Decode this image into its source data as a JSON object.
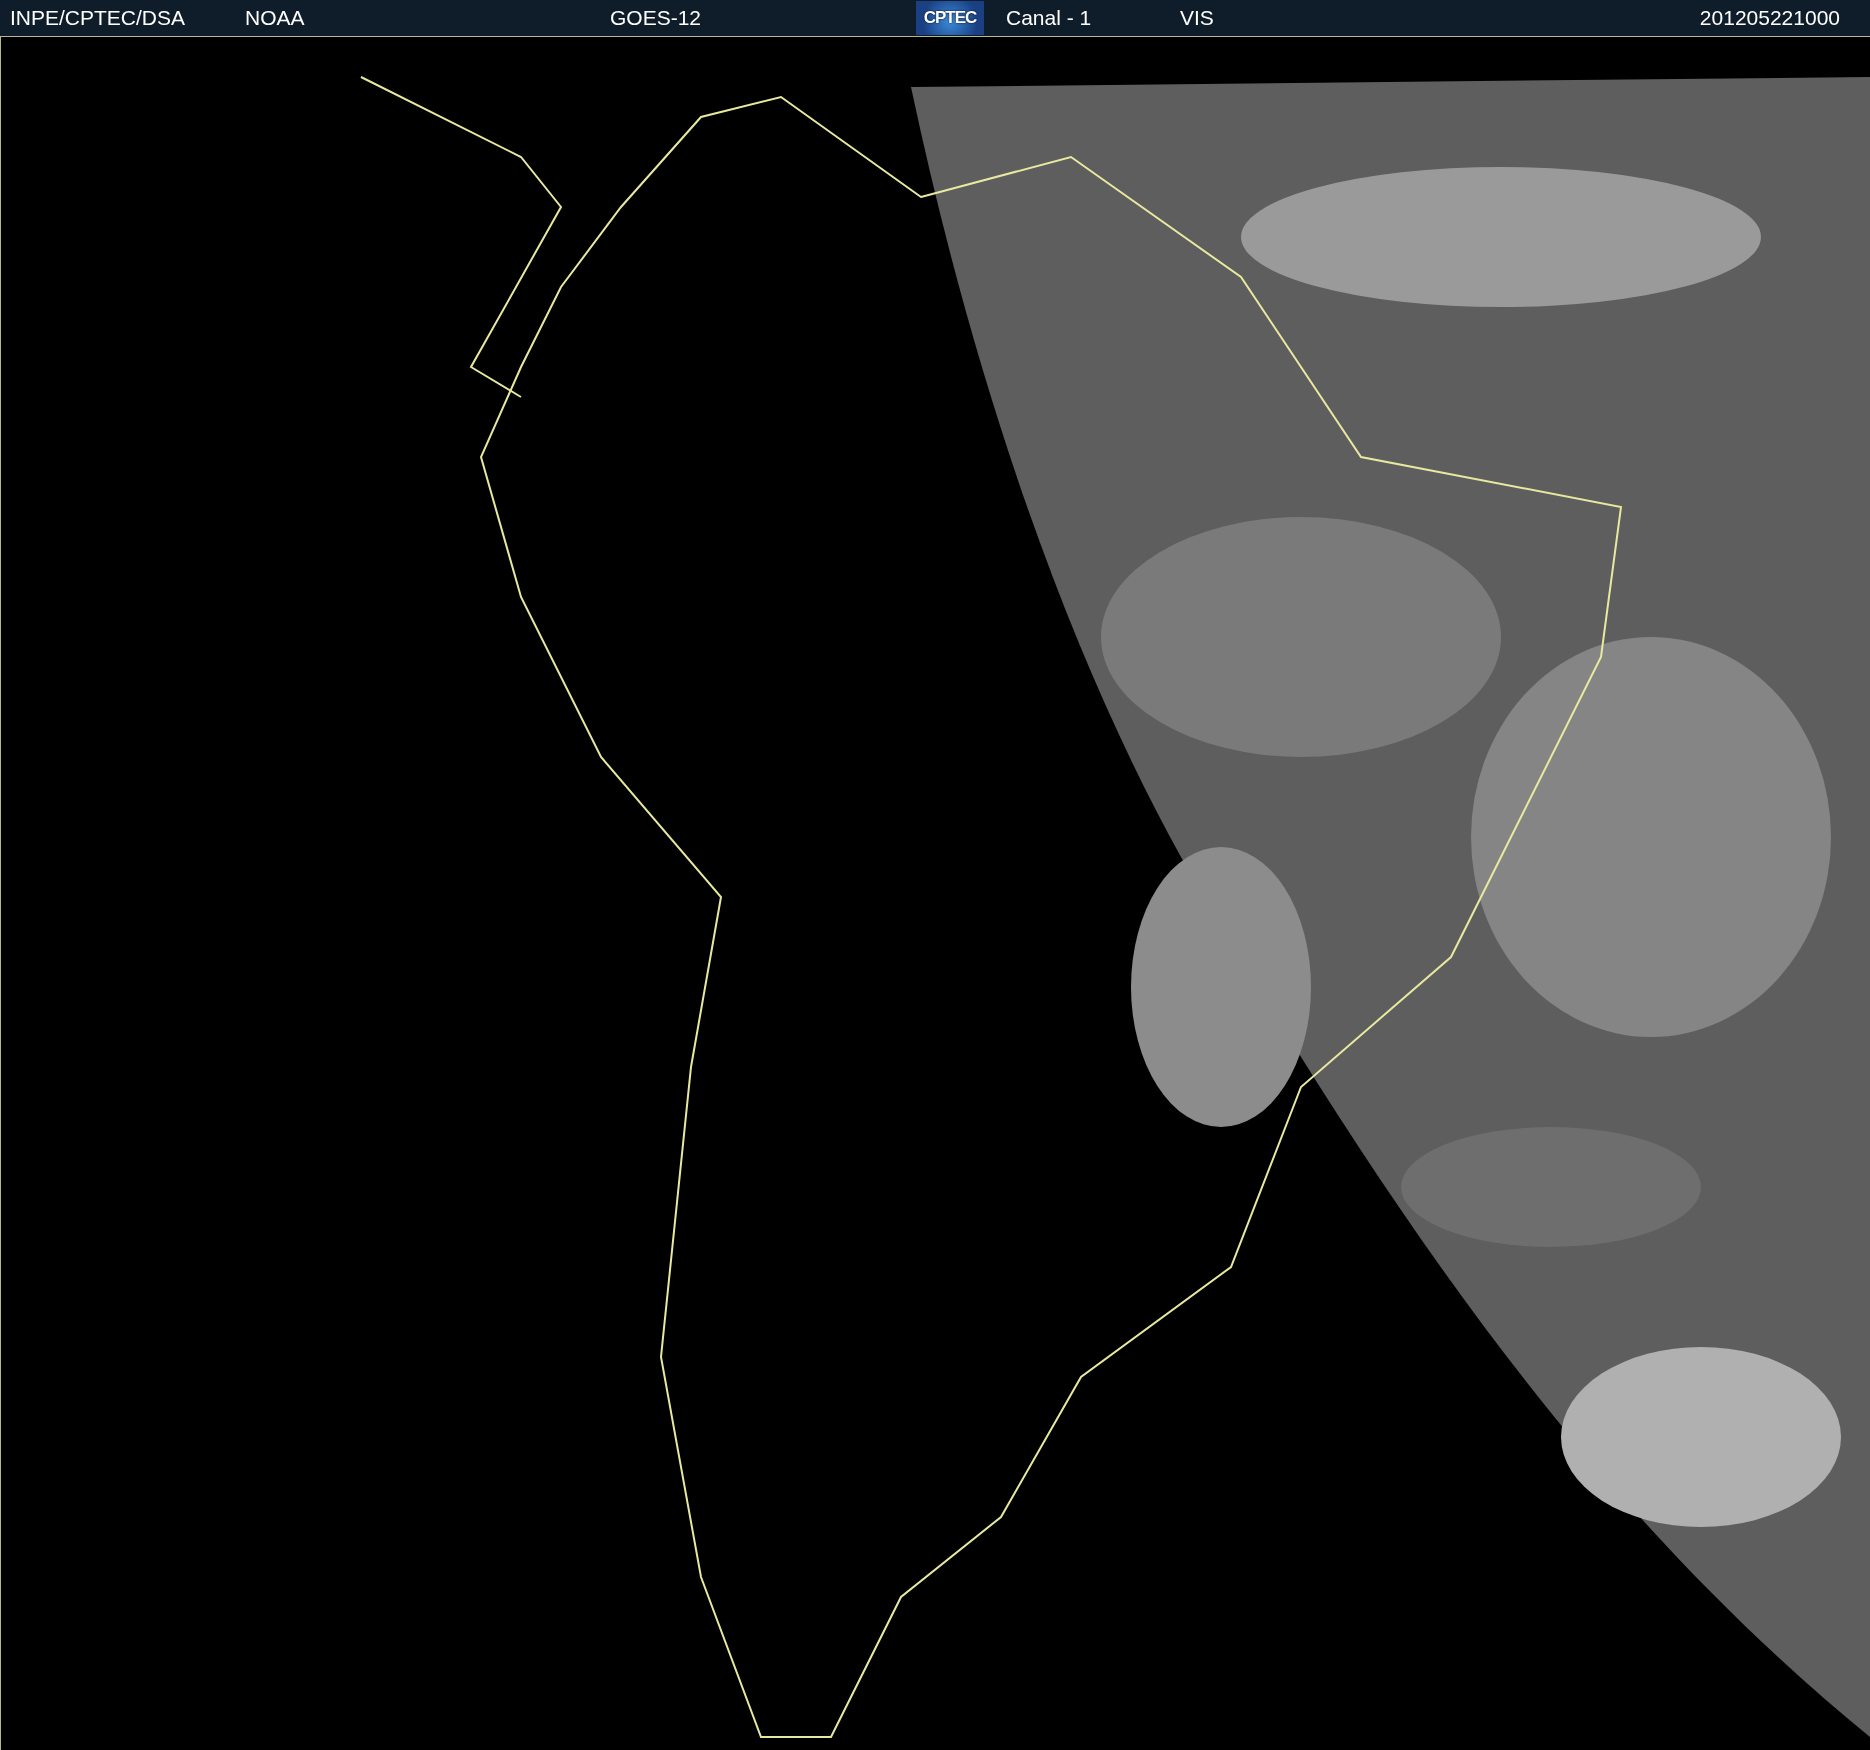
{
  "header": {
    "source": "INPE/CPTEC/DSA",
    "agency": "NOAA",
    "satellite": "GOES-12",
    "logo": "CPTEC",
    "channel": "Canal - 1",
    "band": "VIS",
    "timestamp": "201205221000"
  }
}
